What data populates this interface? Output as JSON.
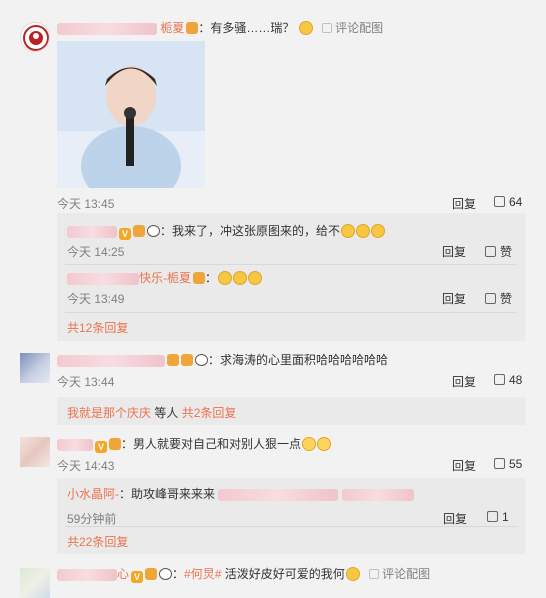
{
  "c1": {
    "text": "：有多骚……瑞？",
    "name": "栀夏",
    "time": "今天 13:45",
    "reply": "回复",
    "likes": "64",
    "comment_pic": "评论配图",
    "subs": [
      {
        "text": "：我来了，冲这张原图来的，给不",
        "time": "今天 14:25",
        "reply": "回复",
        "like": "赞"
      },
      {
        "name": "快乐-栀夏",
        "time": "今天 13:49",
        "reply": "回复",
        "like": "赞"
      }
    ],
    "more": "共12条回复"
  },
  "c2": {
    "text": "：求海涛的心里面积哈哈哈哈哈哈",
    "time": "今天 13:44",
    "reply": "回复",
    "likes": "48",
    "link_name": "我就是那个庆庆",
    "link_mid": " 等人 ",
    "link_more": "共2条回复"
  },
  "c3": {
    "text": "：男人就要对自己和对别人狠一点",
    "time": "今天 14:43",
    "reply": "回复",
    "likes": "55",
    "sub": {
      "name": "小水晶阿-",
      "text": "：助攻峰哥来来来",
      "time": "59分钟前",
      "reply": "回复",
      "likes": "1"
    },
    "more": "共22条回复"
  },
  "c4": {
    "name_end": "心",
    "tag": "#何炅#",
    "text": " 活泼好皮好可爱的我何",
    "comment_pic": "评论配图"
  }
}
